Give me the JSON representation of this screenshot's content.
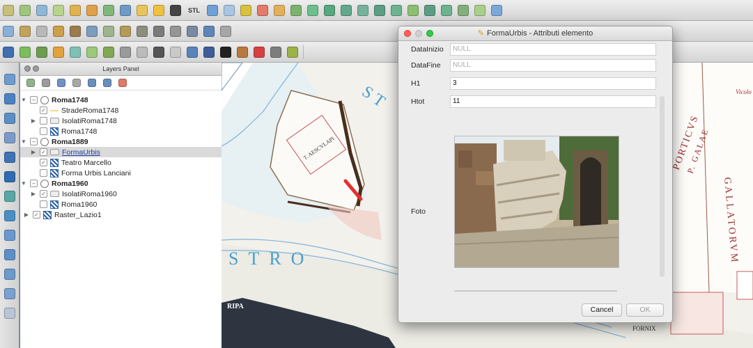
{
  "toolbar": {
    "stl_label": "STL"
  },
  "layers_panel": {
    "title": "Layers Panel",
    "groups": [
      {
        "name": "Roma1748",
        "layers": [
          {
            "label": "StradeRoma1748"
          },
          {
            "label": "IsolatiRoma1748"
          },
          {
            "label": "Roma1748"
          }
        ]
      },
      {
        "name": "Roma1889",
        "layers": [
          {
            "label": "FormaUrbis"
          },
          {
            "label": "Teatro Marcello"
          },
          {
            "label": "Forma Urbis Lanciani"
          }
        ]
      },
      {
        "name": "Roma1960",
        "layers": [
          {
            "label": "IsolatiRoma1960"
          },
          {
            "label": "Roma1960"
          }
        ]
      }
    ],
    "extra_layer": {
      "label": "Raster_Lazio1"
    }
  },
  "map": {
    "labels": {
      "stro": "STRO",
      "st": "ST",
      "ripa": "RIPA",
      "porticus": "PORTICVS",
      "galae": "P. GALAE",
      "gallatorum": "GALLATORVM",
      "aescvlapi": "T. AESCVLAPI",
      "vicolo": "Vicolo",
      "fornix": "FORNIX"
    }
  },
  "dialog": {
    "title": "FormaUrbis - Attributi elemento",
    "fields": [
      {
        "label": "DataInizio",
        "value": "NULL"
      },
      {
        "label": "DataFine",
        "value": "NULL"
      },
      {
        "label": "H1",
        "value": "3"
      },
      {
        "label": "Htot",
        "value": "11"
      }
    ],
    "photo_label": "Foto",
    "buttons": {
      "cancel": "Cancel",
      "ok": "OK"
    }
  },
  "colors": {
    "accent_red": "#e53030",
    "dialog_close": "#fc5f57",
    "dialog_max": "#34c84a"
  }
}
